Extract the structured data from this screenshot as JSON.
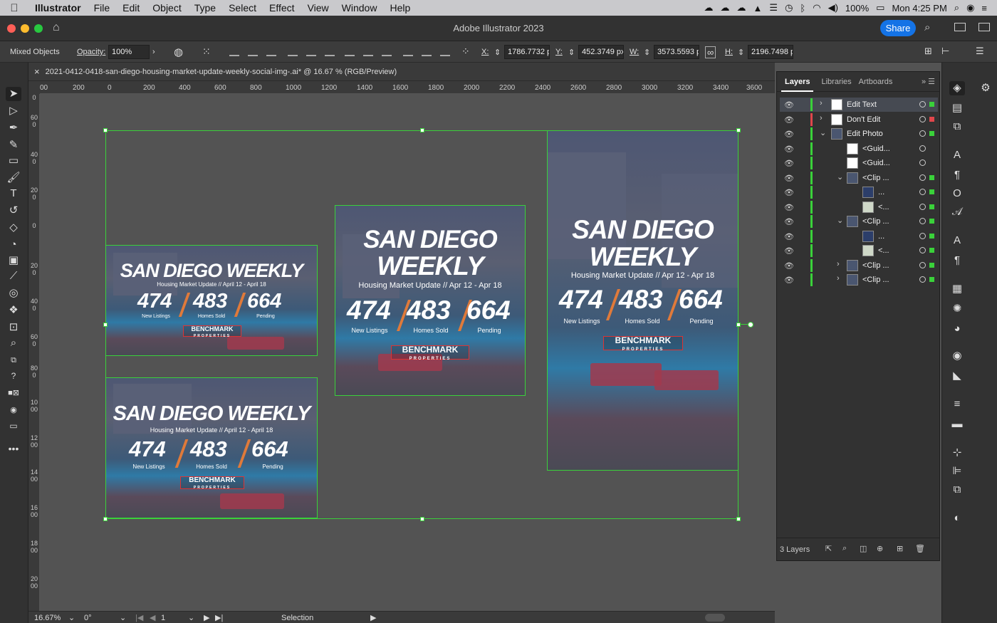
{
  "menubar": {
    "app": "Illustrator",
    "items": [
      "File",
      "Edit",
      "Object",
      "Type",
      "Select",
      "Effect",
      "View",
      "Window",
      "Help"
    ],
    "battery": "100%",
    "clock": "Mon 4:25 PM"
  },
  "window": {
    "title": "Adobe Illustrator 2023",
    "share_label": "Share"
  },
  "control_bar": {
    "selection_type": "Mixed Objects",
    "opacity_label": "Opacity:",
    "opacity_value": "100%",
    "x_label": "X:",
    "x_value": "1786.7732 p",
    "y_label": "Y:",
    "y_value": "452.3749 px",
    "w_label": "W:",
    "w_value": "3573.5593 p",
    "h_label": "H:",
    "h_value": "2196.7498 p"
  },
  "document_tab": {
    "close_glyph": "×",
    "title": "2021-0412-0418-san-diego-housing-market-update-weekly-social-img-.ai* @ 16.67 % (RGB/Preview)"
  },
  "ruler": {
    "h_ticks": [
      "00",
      "200",
      "0",
      "200",
      "400",
      "600",
      "800",
      "1000",
      "1200",
      "1400",
      "1600",
      "1800",
      "2000",
      "2200",
      "2400",
      "2600",
      "2800",
      "3000",
      "3200",
      "3400",
      "3600"
    ],
    "v_ticks": [
      "0",
      "600",
      "400",
      "200",
      "0",
      "200",
      "400",
      "600",
      "800",
      "1000",
      "1200",
      "1400",
      "1600",
      "1800",
      "2000"
    ]
  },
  "artboards": [
    {
      "headline": "SAN DIEGO WEEKLY",
      "subtitle": "Housing Market Update // April 12 - April 18",
      "stats": [
        {
          "value": "474",
          "label": "New Listings"
        },
        {
          "value": "483",
          "label": "Homes Sold"
        },
        {
          "value": "664",
          "label": "Pending"
        }
      ],
      "logo": "BENCHMARK",
      "logo_sub": "PROPERTIES"
    },
    {
      "headline": "SAN DIEGO WEEKLY",
      "subtitle": "Housing Market Update // April 12 - April 18",
      "stats": [
        {
          "value": "474",
          "label": "New Listings"
        },
        {
          "value": "483",
          "label": "Homes Sold"
        },
        {
          "value": "664",
          "label": "Pending"
        }
      ],
      "logo": "BENCHMARK",
      "logo_sub": "PROPERTIES"
    },
    {
      "headline_1": "SAN DIEGO",
      "headline_2": "WEEKLY",
      "subtitle": "Housing Market Update // Apr 12 - Apr 18",
      "stats": [
        {
          "value": "474",
          "label": "New Listings"
        },
        {
          "value": "483",
          "label": "Homes Sold"
        },
        {
          "value": "664",
          "label": "Pending"
        }
      ],
      "logo": "BENCHMARK",
      "logo_sub": "PROPERTIES"
    },
    {
      "headline_1": "SAN DIEGO",
      "headline_2": "WEEKLY",
      "subtitle": "Housing Market Update // Apr 12 - Apr 18",
      "stats": [
        {
          "value": "474",
          "label": "New Listings"
        },
        {
          "value": "483",
          "label": "Homes Sold"
        },
        {
          "value": "664",
          "label": "Pending"
        }
      ],
      "logo": "BENCHMARK",
      "logo_sub": "PROPERTIES"
    }
  ],
  "status_bar": {
    "zoom": "16.67%",
    "rotation": "0°",
    "artboard_number": "1",
    "tool": "Selection"
  },
  "layers_panel": {
    "tabs": [
      "Layers",
      "Libraries",
      "Artboards"
    ],
    "rows": [
      {
        "name": "Edit Text",
        "color": "#3ad13a",
        "sq": "#3ad13a"
      },
      {
        "name": "Don't Edit",
        "color": "#e0464b",
        "sq": "#e0464b"
      },
      {
        "name": "Edit Photo",
        "color": "#3ad13a",
        "sq": "#3ad13a"
      },
      {
        "name": "<Guid...",
        "color": "#3ad13a",
        "sq": ""
      },
      {
        "name": "<Guid...",
        "color": "#3ad13a",
        "sq": ""
      },
      {
        "name": "<Clip ...",
        "color": "#3ad13a",
        "sq": "#3ad13a"
      },
      {
        "name": "...",
        "color": "#3ad13a",
        "sq": "#3ad13a"
      },
      {
        "name": "<...",
        "color": "#3ad13a",
        "sq": "#3ad13a"
      },
      {
        "name": "<Clip ...",
        "color": "#3ad13a",
        "sq": "#3ad13a"
      },
      {
        "name": "...",
        "color": "#3ad13a",
        "sq": "#3ad13a"
      },
      {
        "name": "<...",
        "color": "#3ad13a",
        "sq": "#3ad13a"
      },
      {
        "name": "<Clip ...",
        "color": "#3ad13a",
        "sq": "#3ad13a"
      },
      {
        "name": "<Clip ...",
        "color": "#3ad13a",
        "sq": "#3ad13a"
      }
    ],
    "count": "3 Layers"
  },
  "icons": {
    "apple": "apple-icon",
    "home": "home-icon",
    "search": "search-icon",
    "eye": "eye-icon"
  },
  "colors": {
    "selection": "#3ad13a",
    "accent": "#1473e6",
    "orange_slash": "#e07a3a"
  }
}
